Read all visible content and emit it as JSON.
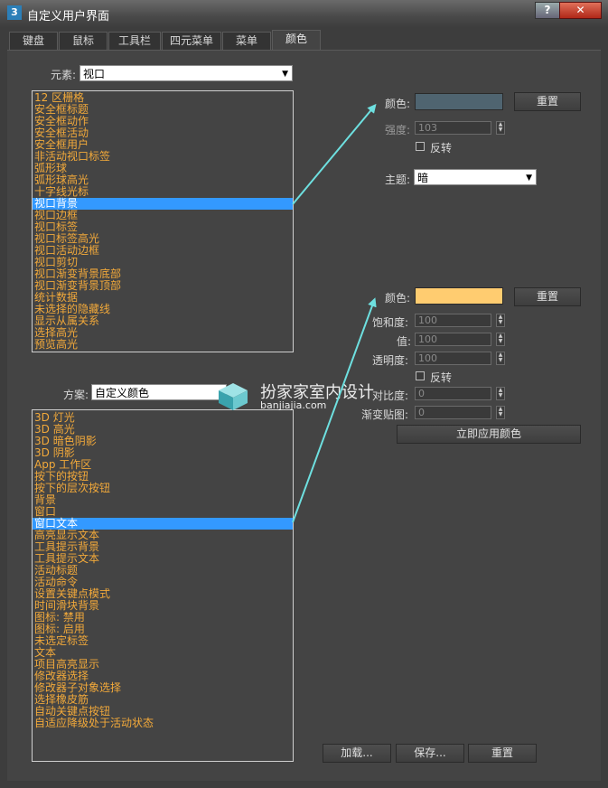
{
  "window": {
    "title": "自定义用户界面",
    "icon": "3ds-max-icon",
    "help_label": "?",
    "close_label": "✕"
  },
  "tabs": [
    {
      "label": "键盘"
    },
    {
      "label": "鼠标"
    },
    {
      "label": "工具栏"
    },
    {
      "label": "四元菜单"
    },
    {
      "label": "菜单"
    },
    {
      "label": "颜色",
      "active": true
    }
  ],
  "elements": {
    "label": "元素:",
    "value": "视口"
  },
  "element_list": [
    "12 区栅格",
    "安全框标题",
    "安全框动作",
    "安全框活动",
    "安全框用户",
    "非活动视口标签",
    "弧形球",
    "弧形球高光",
    "十字线光标",
    "视口背景",
    "视口边框",
    "视口标签",
    "视口标签高光",
    "视口活动边框",
    "视口剪切",
    "视口渐变背景底部",
    "视口渐变背景顶部",
    "统计数据",
    "未选择的隐藏线",
    "显示从属关系",
    "选择高光",
    "预览高光"
  ],
  "element_selected_index": 9,
  "scheme": {
    "label": "方案:",
    "value": "自定义颜色"
  },
  "scheme_list": [
    "3D 灯光",
    "3D 高光",
    "3D 暗色阴影",
    "3D 阴影",
    "App 工作区",
    "按下的按钮",
    "按下的层次按钮",
    "背景",
    "窗口",
    "窗口文本",
    "高亮显示文本",
    "工具提示背景",
    "工具提示文本",
    "活动标题",
    "活动命令",
    "设置关键点模式",
    "时间滑块背景",
    "图标: 禁用",
    "图标: 启用",
    "未选定标签",
    "文本",
    "项目高亮显示",
    "修改器选择",
    "修改器子对象选择",
    "选择橡皮筋",
    "自动关键点按钮",
    "自适应降级处于活动状态"
  ],
  "scheme_selected_index": 9,
  "top_panel": {
    "color_label": "颜色:",
    "color_value": "#4f6470",
    "reset_label": "重置",
    "intensity_label": "强度:",
    "intensity_value": "103",
    "invert_label": "反转",
    "theme_label": "主题:",
    "theme_value": "暗"
  },
  "bottom_panel": {
    "color_label": "颜色:",
    "color_value": "#ffcc70",
    "reset_label": "重置",
    "saturation_label": "饱和度:",
    "saturation_value": "100",
    "value_label": "值:",
    "value_value": "100",
    "transparency_label": "透明度:",
    "transparency_value": "100",
    "invert_label": "反转",
    "contrast_label": "对比度:",
    "contrast_value": "0",
    "gradient_label": "渐变贴图:",
    "gradient_value": "0",
    "apply_label": "立即应用颜色"
  },
  "footer": {
    "load_label": "加载...",
    "save_label": "保存...",
    "reset_label": "重置"
  },
  "watermark": {
    "text": "扮家家室内设计",
    "url": "banjiajia.com"
  },
  "colors": {
    "arrow": "#6ee0e0",
    "selection": "#3399ff",
    "list_text": "#f2a93a"
  }
}
